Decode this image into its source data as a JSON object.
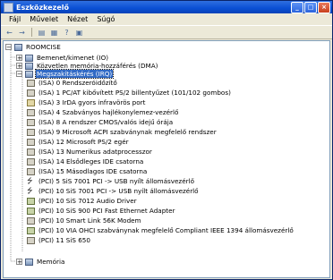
{
  "window": {
    "title": "Eszközkezelő",
    "controls": [
      "_",
      "□",
      "×"
    ]
  },
  "menu": [
    "Fájl",
    "Művelet",
    "Nézet",
    "Súgó"
  ],
  "toolbar": {
    "back": "←",
    "forward": "→",
    "b1": "▤",
    "b2": "▦",
    "b3": "?",
    "b4": "▣"
  },
  "tree": {
    "root": {
      "expander": "−",
      "label": "ROOMCISE"
    },
    "categories": [
      {
        "expander": "+",
        "label": "Bemenet/kimenet (IO)"
      },
      {
        "expander": "+",
        "label": "Közvetlen memória-hozzáférés (DMA)"
      },
      {
        "expander": "−",
        "label": "Megszakításkérés (IRQ)"
      }
    ],
    "irq_items": [
      "(ISA)  0    Rendszeróidőzítő",
      "(ISA)  1    PC/AT kibővített PS/2 billentyűzet (101/102 gombos)",
      "(ISA)  3    IrDA gyors infravörös port",
      "(ISA)  4    Szabványos hajlékonylemez-vezérlő",
      "(ISA)  8    A rendszer CMOS/valós idejű órája",
      "(ISA)  9    Microsoft ACPI szabványnak megfelelő rendszer",
      "(ISA)  12    Microsoft PS/2 egér",
      "(ISA)  13    Numerikus adatprocesszor",
      "(ISA)  14    Elsődleges IDE csatorna",
      "(ISA)  15    Másodlagos IDE csatorna",
      "(PCI)  5    SiS 7001 PCI -> USB nyílt állomásvezérlő",
      "(PCI)  10    SiS 7001 PCI -> USB nyílt állomásvezérlő",
      "(PCI)  10    SiS 7012 Audio Driver",
      "(PCI)  10    SiS 900 PCI Fast Ethernet Adapter",
      "(PCI)  10    Smart Link 56K Modem",
      "(PCI)  10    VIA OHCI szabványnak megfelelő Compliant IEEE 1394 állomásvezérlő",
      "(PCI)  11    SiS 650"
    ],
    "last": {
      "expander": "+",
      "label": "Memória"
    }
  }
}
